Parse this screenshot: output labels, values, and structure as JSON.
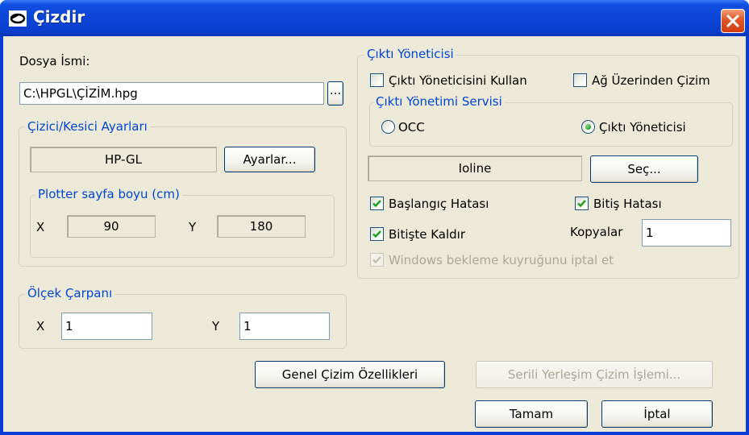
{
  "window": {
    "title": "Çizdir",
    "icon": "app-icon",
    "close_icon": "close-icon"
  },
  "file": {
    "label": "Dosya İsmi:",
    "value": "C:\\HPGL\\ÇİZİM.hpg",
    "browse_label": "..."
  },
  "plotter_settings": {
    "title": "Çizici/Kesici Ayarları",
    "format_value": "HP-GL",
    "settings_button": "Ayarlar...",
    "page_size": {
      "title": "Plotter sayfa boyu (cm)",
      "x_label": "X",
      "x_value": "90",
      "y_label": "Y",
      "y_value": "180"
    }
  },
  "scale": {
    "title": "Ölçek Çarpanı",
    "x_label": "X",
    "x_value": "1",
    "y_label": "Y",
    "y_value": "1"
  },
  "output_manager": {
    "title": "Çıktı Yöneticisi",
    "use_manager_label": "Çıktı Yöneticisini Kullan",
    "use_manager_checked": false,
    "network_plot_label": "Ağ Üzerinden Çizim",
    "network_plot_checked": false,
    "service": {
      "title": "Çıktı Yönetimi Servisi",
      "option_occ": "OCC",
      "option_manager": "Çıktı Yöneticisi",
      "selected": "Çıktı Yöneticisi"
    },
    "device_value": "Ioline",
    "select_button": "Seç...",
    "start_error_label": "Başlangıç Hatası",
    "start_error_checked": true,
    "end_error_label": "Bitiş Hatası",
    "end_error_checked": true,
    "lift_at_end_label": "Bitişte Kaldır",
    "lift_at_end_checked": true,
    "copies_label": "Kopyalar",
    "copies_value": "1",
    "cancel_queue_label": "Windows bekleme kuyruğunu iptal et",
    "cancel_queue_checked": true
  },
  "buttons": {
    "general_props": "Genel Çizim Özellikleri",
    "serial_layout": "Serili Yerleşim Çizim İşlemi...",
    "ok": "Tamam",
    "cancel": "İptal"
  },
  "colors": {
    "titlebar": "#0a45d8",
    "dialog_bg": "#ece9d8",
    "group_title": "#0046d5",
    "close_button": "#e25a2a"
  }
}
